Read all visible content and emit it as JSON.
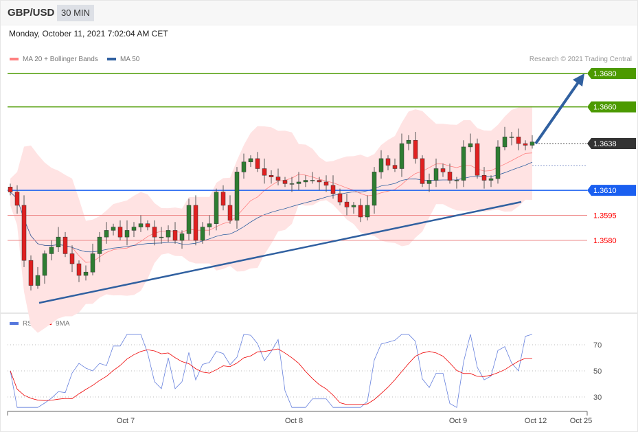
{
  "header": {
    "symbol": "GBP/USD",
    "timeframe": "30 MIN",
    "datetime": "Monday, October 11, 2021 7:02:04 AM CET"
  },
  "legend": {
    "ma20": "MA 20 + Bollinger Bands",
    "ma50": "MA 50",
    "rsi": "RSI",
    "ma9": "9MA",
    "copyright": "Research © 2021 Trading Central"
  },
  "colors": {
    "up": "#2e7d32",
    "down": "#e02020",
    "band": "#ffe3e3",
    "ma20": "#ff8080",
    "ma50": "#3060a0",
    "resistance": "#4c9a00",
    "support": "#1a5ff0"
  },
  "levels": [
    {
      "label": "1.3680",
      "price": 1.368,
      "type": "resistance"
    },
    {
      "label": "1.3660",
      "price": 1.366,
      "type": "resistance"
    },
    {
      "label": "1.3638",
      "price": 1.3638,
      "type": "last"
    },
    {
      "label": "1.3610",
      "price": 1.361,
      "type": "pivot"
    },
    {
      "label": "1.3595",
      "price": 1.3595,
      "type": "support"
    },
    {
      "label": "1.3580",
      "price": 1.358,
      "type": "support"
    }
  ],
  "chart_data": {
    "type": "candlestick",
    "closes": [
      1.3609,
      1.3601,
      1.3568,
      1.3553,
      1.3559,
      1.3572,
      1.3576,
      1.3582,
      1.3572,
      1.3566,
      1.3559,
      1.3561,
      1.3572,
      1.3582,
      1.3586,
      1.3588,
      1.3582,
      1.3586,
      1.3588,
      1.359,
      1.3588,
      1.3582,
      1.3582,
      1.3586,
      1.358,
      1.3584,
      1.3601,
      1.358,
      1.3588,
      1.359,
      1.3609,
      1.3601,
      1.3592,
      1.3621,
      1.3627,
      1.3629,
      1.3623,
      1.3619,
      1.3618,
      1.3616,
      1.3614,
      1.3614,
      1.3615,
      1.3616,
      1.3616,
      1.3615,
      1.3613,
      1.3608,
      1.3603,
      1.36,
      1.3601,
      1.3594,
      1.3601,
      1.3621,
      1.3629,
      1.3625,
      1.3623,
      1.3638,
      1.364,
      1.3629,
      1.3614,
      1.3616,
      1.3623,
      1.3621,
      1.3616,
      1.3616,
      1.3636,
      1.3638,
      1.3619,
      1.3616,
      1.3617,
      1.3636,
      1.3642,
      1.3642,
      1.3638,
      1.3637,
      1.3639
    ],
    "price_range": [
      1.3545,
      1.3685
    ],
    "x_labels": [
      "Oct 7",
      "Oct 8",
      "Oct 9",
      "Oct 12",
      "Oct 25"
    ],
    "rsi_ticks": [
      "70",
      "50",
      "30"
    ]
  }
}
